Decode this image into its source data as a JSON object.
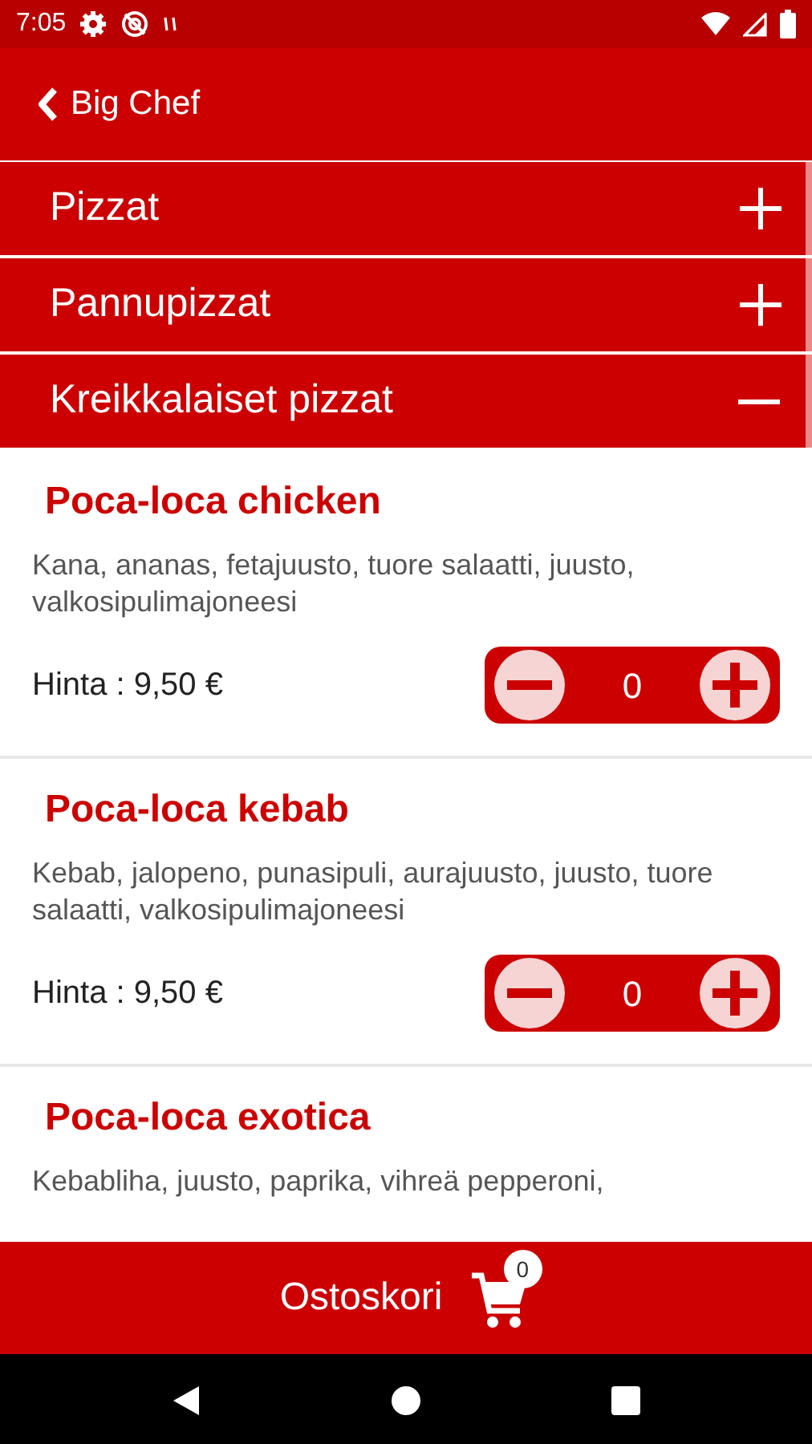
{
  "status_bar": {
    "time": "7:05"
  },
  "header": {
    "title": "Big Chef"
  },
  "categories": [
    {
      "label": "Pizzat",
      "expanded": false
    },
    {
      "label": "Pannupizzat",
      "expanded": false
    },
    {
      "label": "Kreikkalaiset pizzat",
      "expanded": true
    }
  ],
  "products": [
    {
      "name": "Poca-loca chicken",
      "description": "Kana, ananas, fetajuusto, tuore salaatti, juusto, valkosipulimajoneesi",
      "price": "Hinta : 9,50 €",
      "quantity": "0"
    },
    {
      "name": "Poca-loca kebab",
      "description": "Kebab, jalopeno, punasipuli, aurajuusto, juusto, tuore salaatti, valkosipulimajoneesi",
      "price": "Hinta : 9,50 €",
      "quantity": "0"
    },
    {
      "name": "Poca-loca exotica",
      "description": "Kebabliha, juusto, paprika, vihreä pepperoni,"
    }
  ],
  "cart": {
    "label": "Ostoskori",
    "count": "0"
  }
}
